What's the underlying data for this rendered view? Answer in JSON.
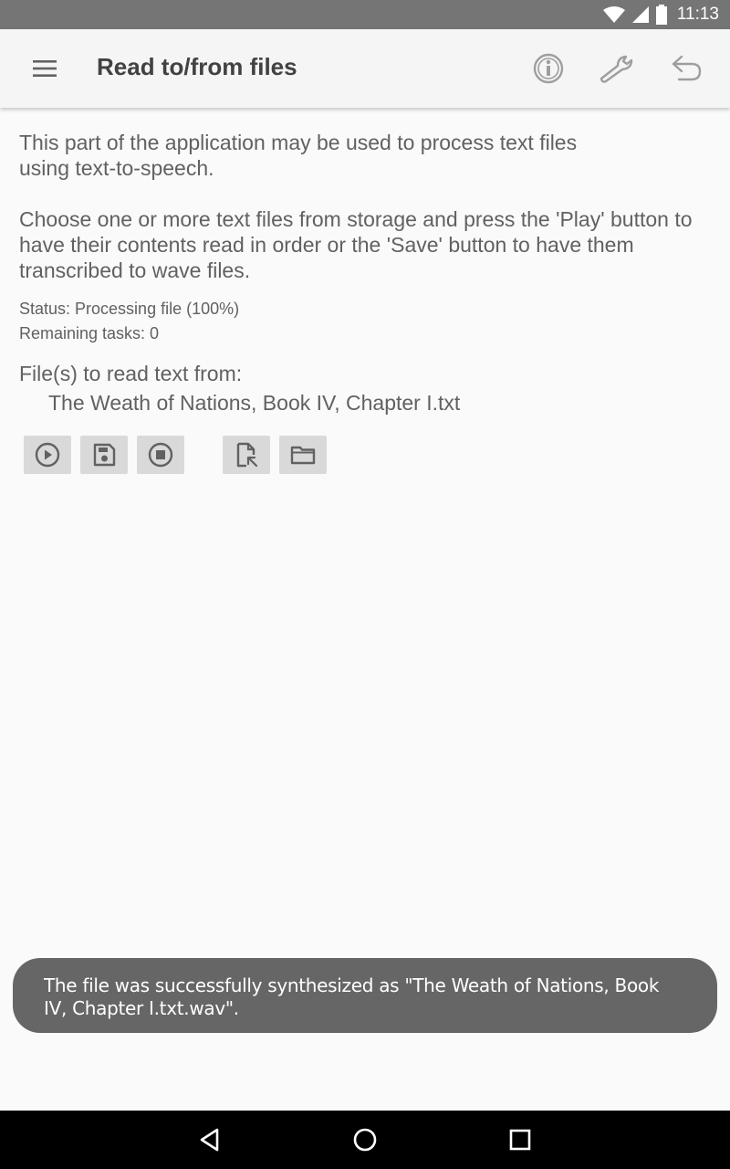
{
  "status_bar": {
    "time": "11:13"
  },
  "app_bar": {
    "title": "Read to/from files",
    "icons": [
      "menu-icon",
      "info-icon",
      "wrench-icon",
      "undo-icon"
    ]
  },
  "content": {
    "intro": "This part of the application may be used to process text files using text-to-speech.",
    "instructions": "Choose one or more text files from storage and press the 'Play' button to have their contents read in order or the 'Save' button to have them transcribed to wave files.",
    "status": "Status: Processing file (100%)",
    "remaining": "Remaining tasks: 0",
    "files_label": "File(s) to read text from:",
    "files": [
      "The Weath of Nations, Book IV, Chapter I.txt"
    ]
  },
  "buttons": [
    "play-icon",
    "save-icon",
    "stop-icon",
    "file-select-icon",
    "folder-icon"
  ],
  "toast": {
    "message": "The file was successfully synthesized as \"The Weath of Nations, Book IV, Chapter I.txt.wav\"."
  },
  "colors": {
    "status_bar": "#757575",
    "app_bar": "#f5f5f5",
    "background": "#fafafa",
    "toast": "#666666",
    "button": "#d9d9d9",
    "text": "#616161"
  }
}
